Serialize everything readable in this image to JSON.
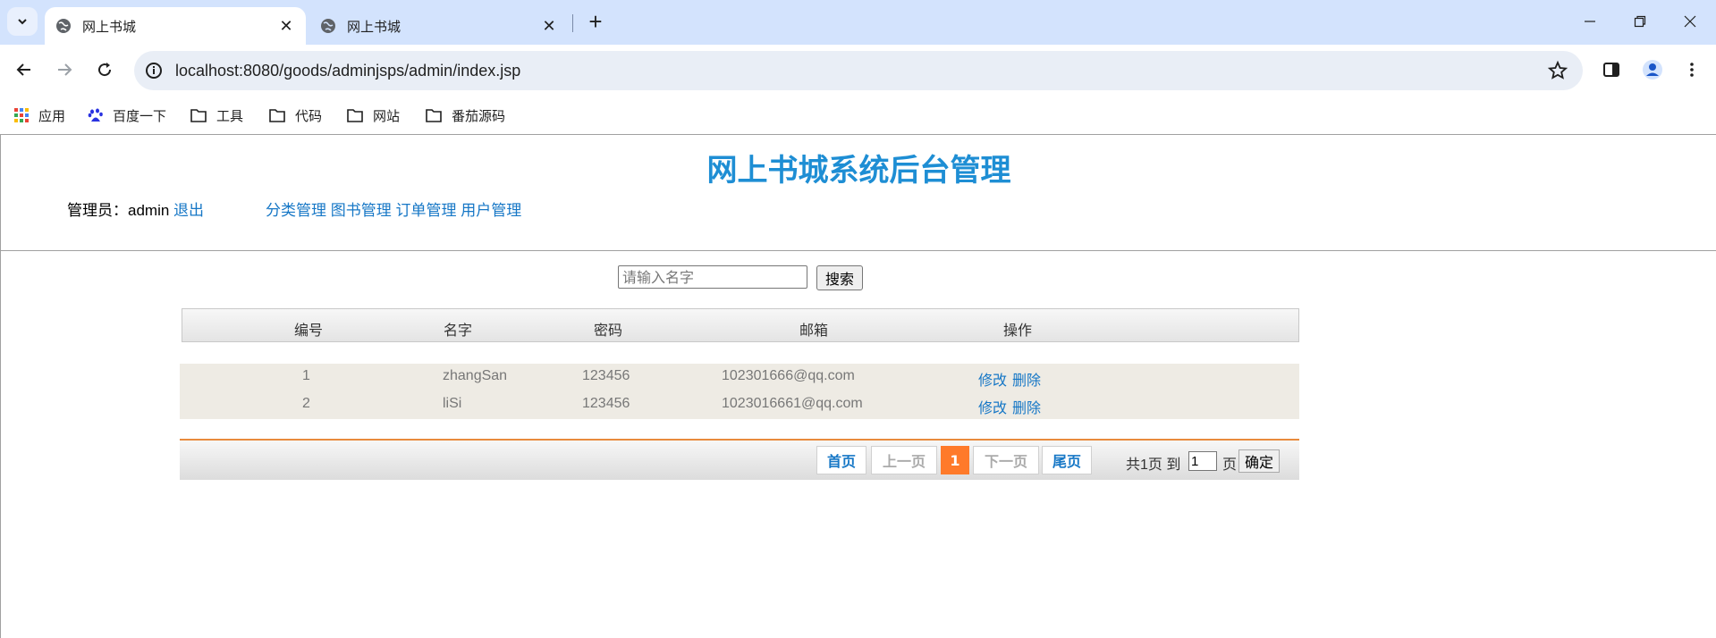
{
  "browser": {
    "tabs": [
      {
        "title": "网上书城",
        "active": true
      },
      {
        "title": "网上书城",
        "active": false
      }
    ],
    "url": "localhost:8080/goods/adminjsps/admin/index.jsp",
    "bookmarks": [
      {
        "label": "应用",
        "icon": "apps-grid-icon"
      },
      {
        "label": "百度一下",
        "icon": "baidu-paw-icon"
      },
      {
        "label": "工具",
        "icon": "folder-icon"
      },
      {
        "label": "代码",
        "icon": "folder-icon"
      },
      {
        "label": "网站",
        "icon": "folder-icon"
      },
      {
        "label": "番茄源码",
        "icon": "folder-icon"
      }
    ]
  },
  "page": {
    "title": "网上书城系统后台管理",
    "admin_label": "管理员：admin",
    "logout": "退出",
    "nav": [
      "分类管理",
      "图书管理",
      "订单管理",
      "用户管理"
    ],
    "search": {
      "placeholder": "请输入名字",
      "button": "搜索"
    },
    "table": {
      "headers": [
        "编号",
        "名字",
        "密码",
        "邮箱",
        "操作"
      ],
      "rows": [
        {
          "id": "1",
          "name": "zhangSan",
          "password": "123456",
          "email": "102301666@qq.com",
          "edit": "修改",
          "delete": "删除"
        },
        {
          "id": "2",
          "name": "liSi",
          "password": "123456",
          "email": "1023016661@qq.com",
          "edit": "修改",
          "delete": "删除"
        }
      ]
    },
    "pager": {
      "first": "首页",
      "prev": "上一页",
      "current": "1",
      "next": "下一页",
      "last": "尾页",
      "total_text": "共1页 到",
      "input_value": "1",
      "page_suffix": "页",
      "ok": "确定"
    }
  },
  "colors": {
    "title_blue": "#1e8ed4",
    "link_blue": "#1677c6",
    "pager_orange": "#ff7a2a",
    "row_bg": "#eeebe4"
  }
}
